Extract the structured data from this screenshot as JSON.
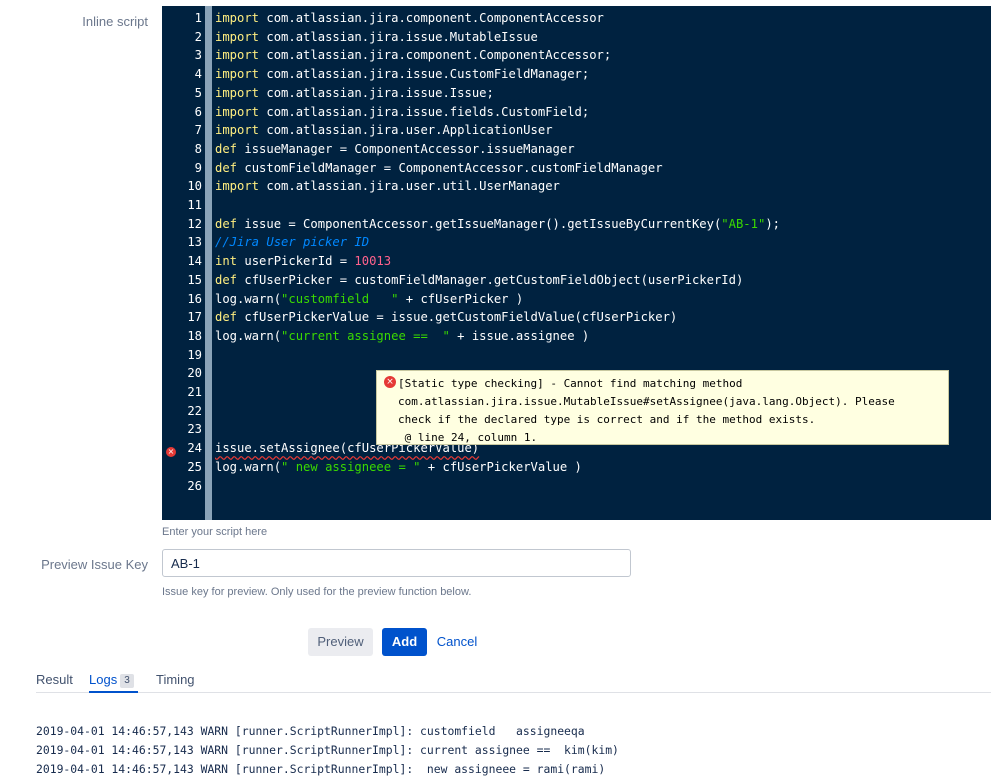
{
  "form": {
    "script_label": "Inline script",
    "script_hint": "Enter your script here",
    "issuekey_label": "Preview Issue Key",
    "issuekey_value": "AB-1",
    "issuekey_hint": "Issue key for preview. Only used for the preview function below."
  },
  "editor": {
    "lines": [
      {
        "n": "1",
        "text": "import com.atlassian.jira.component.ComponentAccessor"
      },
      {
        "n": "2",
        "text": "import com.atlassian.jira.issue.MutableIssue"
      },
      {
        "n": "3",
        "text": "import com.atlassian.jira.component.ComponentAccessor;"
      },
      {
        "n": "4",
        "text": "import com.atlassian.jira.issue.CustomFieldManager;"
      },
      {
        "n": "5",
        "text": "import com.atlassian.jira.issue.Issue;"
      },
      {
        "n": "6",
        "text": "import com.atlassian.jira.issue.fields.CustomField;"
      },
      {
        "n": "7",
        "text": "import com.atlassian.jira.user.ApplicationUser"
      },
      {
        "n": "8",
        "text": "def issueManager = ComponentAccessor.issueManager"
      },
      {
        "n": "9",
        "text": "def customFieldManager = ComponentAccessor.customFieldManager"
      },
      {
        "n": "10",
        "text": "import com.atlassian.jira.user.util.UserManager"
      },
      {
        "n": "11",
        "text": ""
      },
      {
        "n": "12",
        "text": "def issue = ComponentAccessor.getIssueManager().getIssueByCurrentKey(\"AB-1\");"
      },
      {
        "n": "13",
        "text": "//Jira User picker ID"
      },
      {
        "n": "14",
        "text": "int userPickerId = 10013"
      },
      {
        "n": "15",
        "text": "def cfUserPicker = customFieldManager.getCustomFieldObject(userPickerId)"
      },
      {
        "n": "16",
        "text": "log.warn(\"customfield   \" + cfUserPicker )"
      },
      {
        "n": "17",
        "text": "def cfUserPickerValue = issue.getCustomFieldValue(cfUserPicker)"
      },
      {
        "n": "18",
        "text": "log.warn(\"current assignee ==  \" + issue.assignee )"
      },
      {
        "n": "19",
        "text": ""
      },
      {
        "n": "20",
        "text": ""
      },
      {
        "n": "21",
        "text": ""
      },
      {
        "n": "22",
        "text": ""
      },
      {
        "n": "23",
        "text": ""
      },
      {
        "n": "24",
        "text": "issue.setAssignee(cfUserPickerValue)"
      },
      {
        "n": "25",
        "text": "log.warn(\" new assigneee = \" + cfUserPickerValue )"
      },
      {
        "n": "26",
        "text": ""
      }
    ],
    "error_line": "24",
    "error_marker": "×",
    "tooltip_icon": "×",
    "tooltip_lines": [
      "[Static type checking] - Cannot find matching method",
      "com.atlassian.jira.issue.MutableIssue#setAssignee(java.lang.Object). Please",
      "check if the declared type is correct and if the method exists.",
      " @ line 24, column 1."
    ]
  },
  "buttons": {
    "preview": "Preview",
    "add": "Add",
    "cancel": "Cancel"
  },
  "tabs": {
    "result": "Result",
    "logs": "Logs",
    "logs_count": "3",
    "timing": "Timing"
  },
  "logs": [
    "2019-04-01 14:46:57,143 WARN [runner.ScriptRunnerImpl]: customfield   assigneeqa",
    "2019-04-01 14:46:57,143 WARN [runner.ScriptRunnerImpl]: current assignee ==  kim(kim)",
    "2019-04-01 14:46:57,143 WARN [runner.ScriptRunnerImpl]:  new assigneee = rami(rami)"
  ],
  "colors": {
    "editor_bg": "#002240",
    "keyword": "#ffee80",
    "string": "#3ad900",
    "number": "#ff628c",
    "comment": "#0088ff",
    "primary_button": "#0052cc",
    "error": "#e53935"
  }
}
